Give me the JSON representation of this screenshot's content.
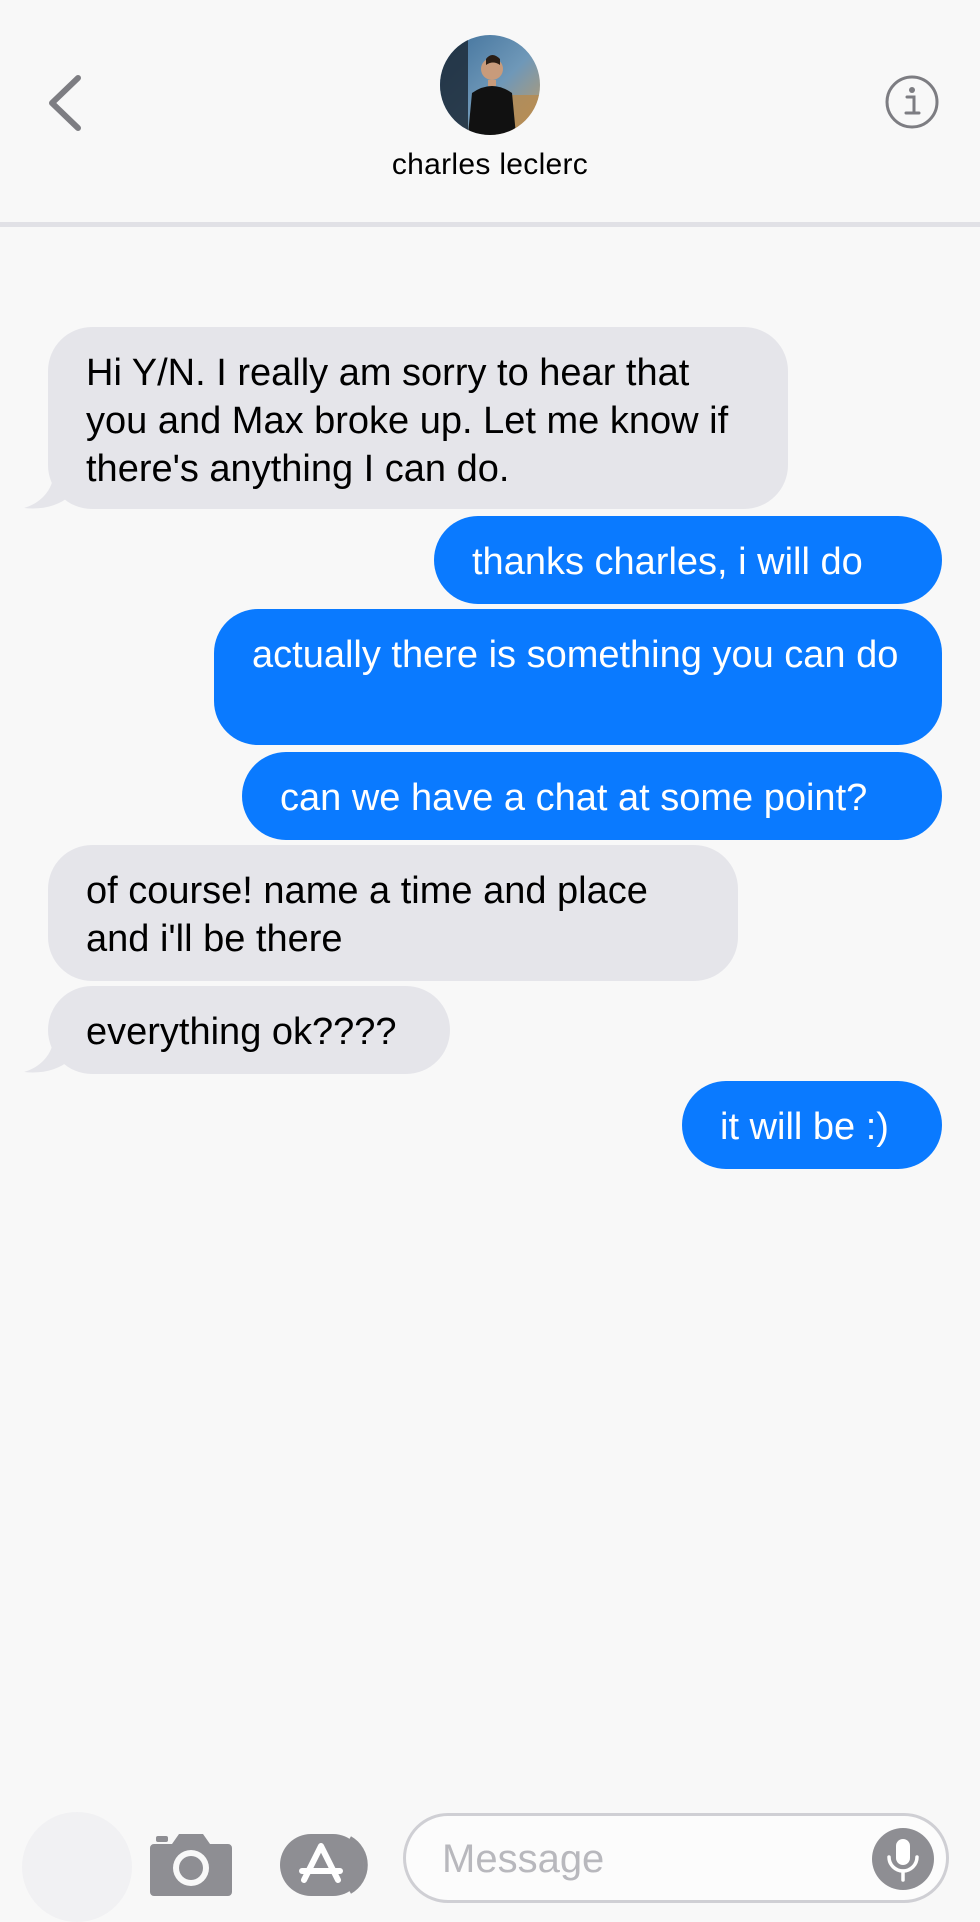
{
  "header": {
    "contact_name": "charles leclerc",
    "back_icon": "chevron-left-icon",
    "info_icon": "info-icon"
  },
  "messages": [
    {
      "direction": "incoming",
      "text": "Hi Y/N. I really am sorry to hear that you and Max broke up. Let me know if there's anything I can do."
    },
    {
      "direction": "outgoing",
      "text": "thanks charles, i will do"
    },
    {
      "direction": "outgoing",
      "text": "actually there is something you can do"
    },
    {
      "direction": "outgoing",
      "text": "can we have a chat at some point?"
    },
    {
      "direction": "incoming",
      "text": "of course! name a time and place and i'll be there"
    },
    {
      "direction": "incoming",
      "text": "everything ok????"
    },
    {
      "direction": "outgoing",
      "text": "it will be :)"
    }
  ],
  "input_bar": {
    "placeholder": "Message",
    "camera_icon": "camera-icon",
    "apps_icon": "app-store-icon",
    "mic_icon": "microphone-icon"
  },
  "colors": {
    "outgoing_bubble": "#0a7aff",
    "incoming_bubble": "#e5e5ea",
    "background": "#f8f8f8"
  }
}
